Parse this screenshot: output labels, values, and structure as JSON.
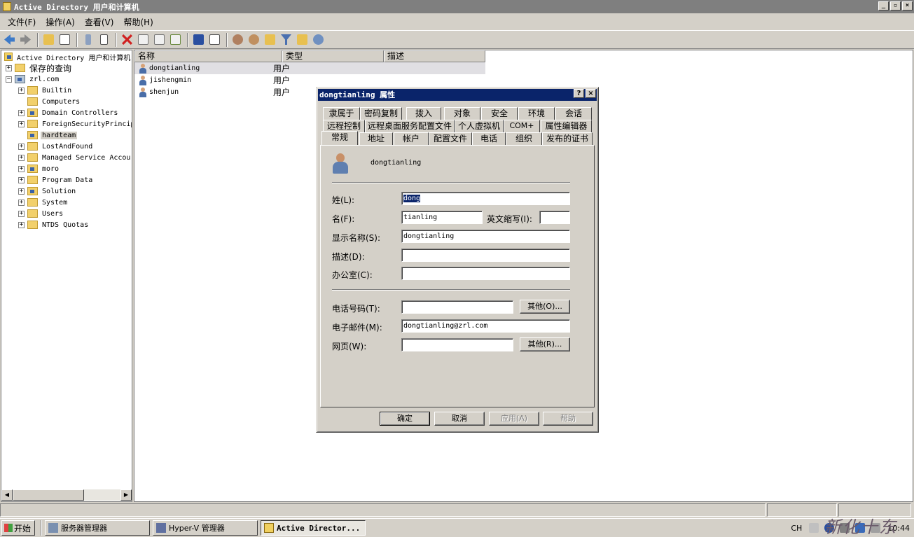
{
  "window": {
    "title": "Active Directory 用户和计算机",
    "controls": [
      "_",
      "▫",
      "×"
    ]
  },
  "menu": [
    "文件(F)",
    "操作(A)",
    "查看(V)",
    "帮助(H)"
  ],
  "toolbar_icons": [
    "back-icon",
    "forward-icon",
    "up-icon",
    "show-hide-tree-icon",
    "cut-icon",
    "copy-icon",
    "delete-icon",
    "properties-icon",
    "refresh-icon",
    "export-icon",
    "help-icon",
    "console-icon",
    "new-user-icon",
    "new-group-icon",
    "new-ou-icon",
    "filter-icon",
    "find-icon",
    "add-to-group-icon"
  ],
  "tree": {
    "root": "Active Directory 用户和计算机",
    "saved_queries": "保存的查询",
    "domain": "zrl.com",
    "nodes": [
      "Builtin",
      "Computers",
      "Domain Controllers",
      "ForeignSecurityPrincip",
      "hardteam",
      "LostAndFound",
      "Managed Service Accour",
      "moro",
      "Program Data",
      "Solution",
      "System",
      "Users",
      "NTDS Quotas"
    ]
  },
  "list": {
    "columns": [
      "名称",
      "类型",
      "描述"
    ],
    "rows": [
      {
        "name": "dongtianling",
        "type": "用户"
      },
      {
        "name": "jishengmin",
        "type": "用户"
      },
      {
        "name": "shenjun",
        "type": "用户"
      }
    ]
  },
  "dialog": {
    "title": "dongtianling 属性",
    "help_btn": "?",
    "close_btn": "×",
    "tabs_row1": [
      "隶属于",
      "密码复制",
      "拨入",
      "对象",
      "安全",
      "环境",
      "会话"
    ],
    "tabs_row2": [
      "远程控制",
      "远程桌面服务配置文件",
      "个人虚拟机",
      "COM+",
      "属性编辑器"
    ],
    "tabs_row3": [
      "常规",
      "地址",
      "帐户",
      "配置文件",
      "电话",
      "组织",
      "发布的证书"
    ],
    "user_display": "dongtianling",
    "labels": {
      "last": "姓(L):",
      "first": "名(F):",
      "initials": "英文缩写(I):",
      "display": "显示名称(S):",
      "desc": "描述(D):",
      "office": "办公室(C):",
      "phone": "电话号码(T):",
      "email": "电子邮件(M):",
      "web": "网页(W):"
    },
    "values": {
      "last": "dong",
      "first": "tianling",
      "initials": "",
      "display": "dongtianling",
      "desc": "",
      "office": "",
      "phone": "",
      "email": "dongtianling@zrl.com",
      "web": ""
    },
    "buttons": {
      "other_phone": "其他(O)...",
      "other_web": "其他(R)...",
      "ok": "确定",
      "cancel": "取消",
      "apply": "应用(A)",
      "help": "帮助"
    }
  },
  "taskbar": {
    "start": "开始",
    "tasks": [
      "服务器管理器",
      "Hyper-V 管理器",
      "Active Director..."
    ],
    "tray_lang": "CH",
    "clock": "10:44"
  },
  "watermark": "新化十东腔"
}
